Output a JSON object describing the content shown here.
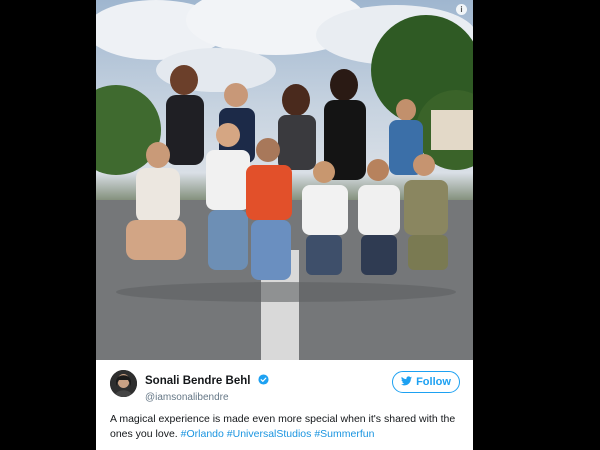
{
  "tweet": {
    "display_name": "Sonali Bendre Behl",
    "handle": "@iamsonalibendre",
    "follow_label": "Follow",
    "text_plain": "A magical experience is made even more special when it's shared with the ones you love.",
    "hashtags": [
      "#Orlando",
      "#UniversalStudios",
      "#Summerfun"
    ]
  },
  "photo": {
    "info_glyph": "i"
  },
  "icons": {
    "verified": "verified-badge-icon",
    "twitter": "twitter-bird-icon",
    "info": "info-icon"
  },
  "colors": {
    "twitter_blue": "#1da1f2",
    "hashtag_blue": "#1b95e0",
    "text": "#14171a",
    "handle_gray": "#657786"
  }
}
